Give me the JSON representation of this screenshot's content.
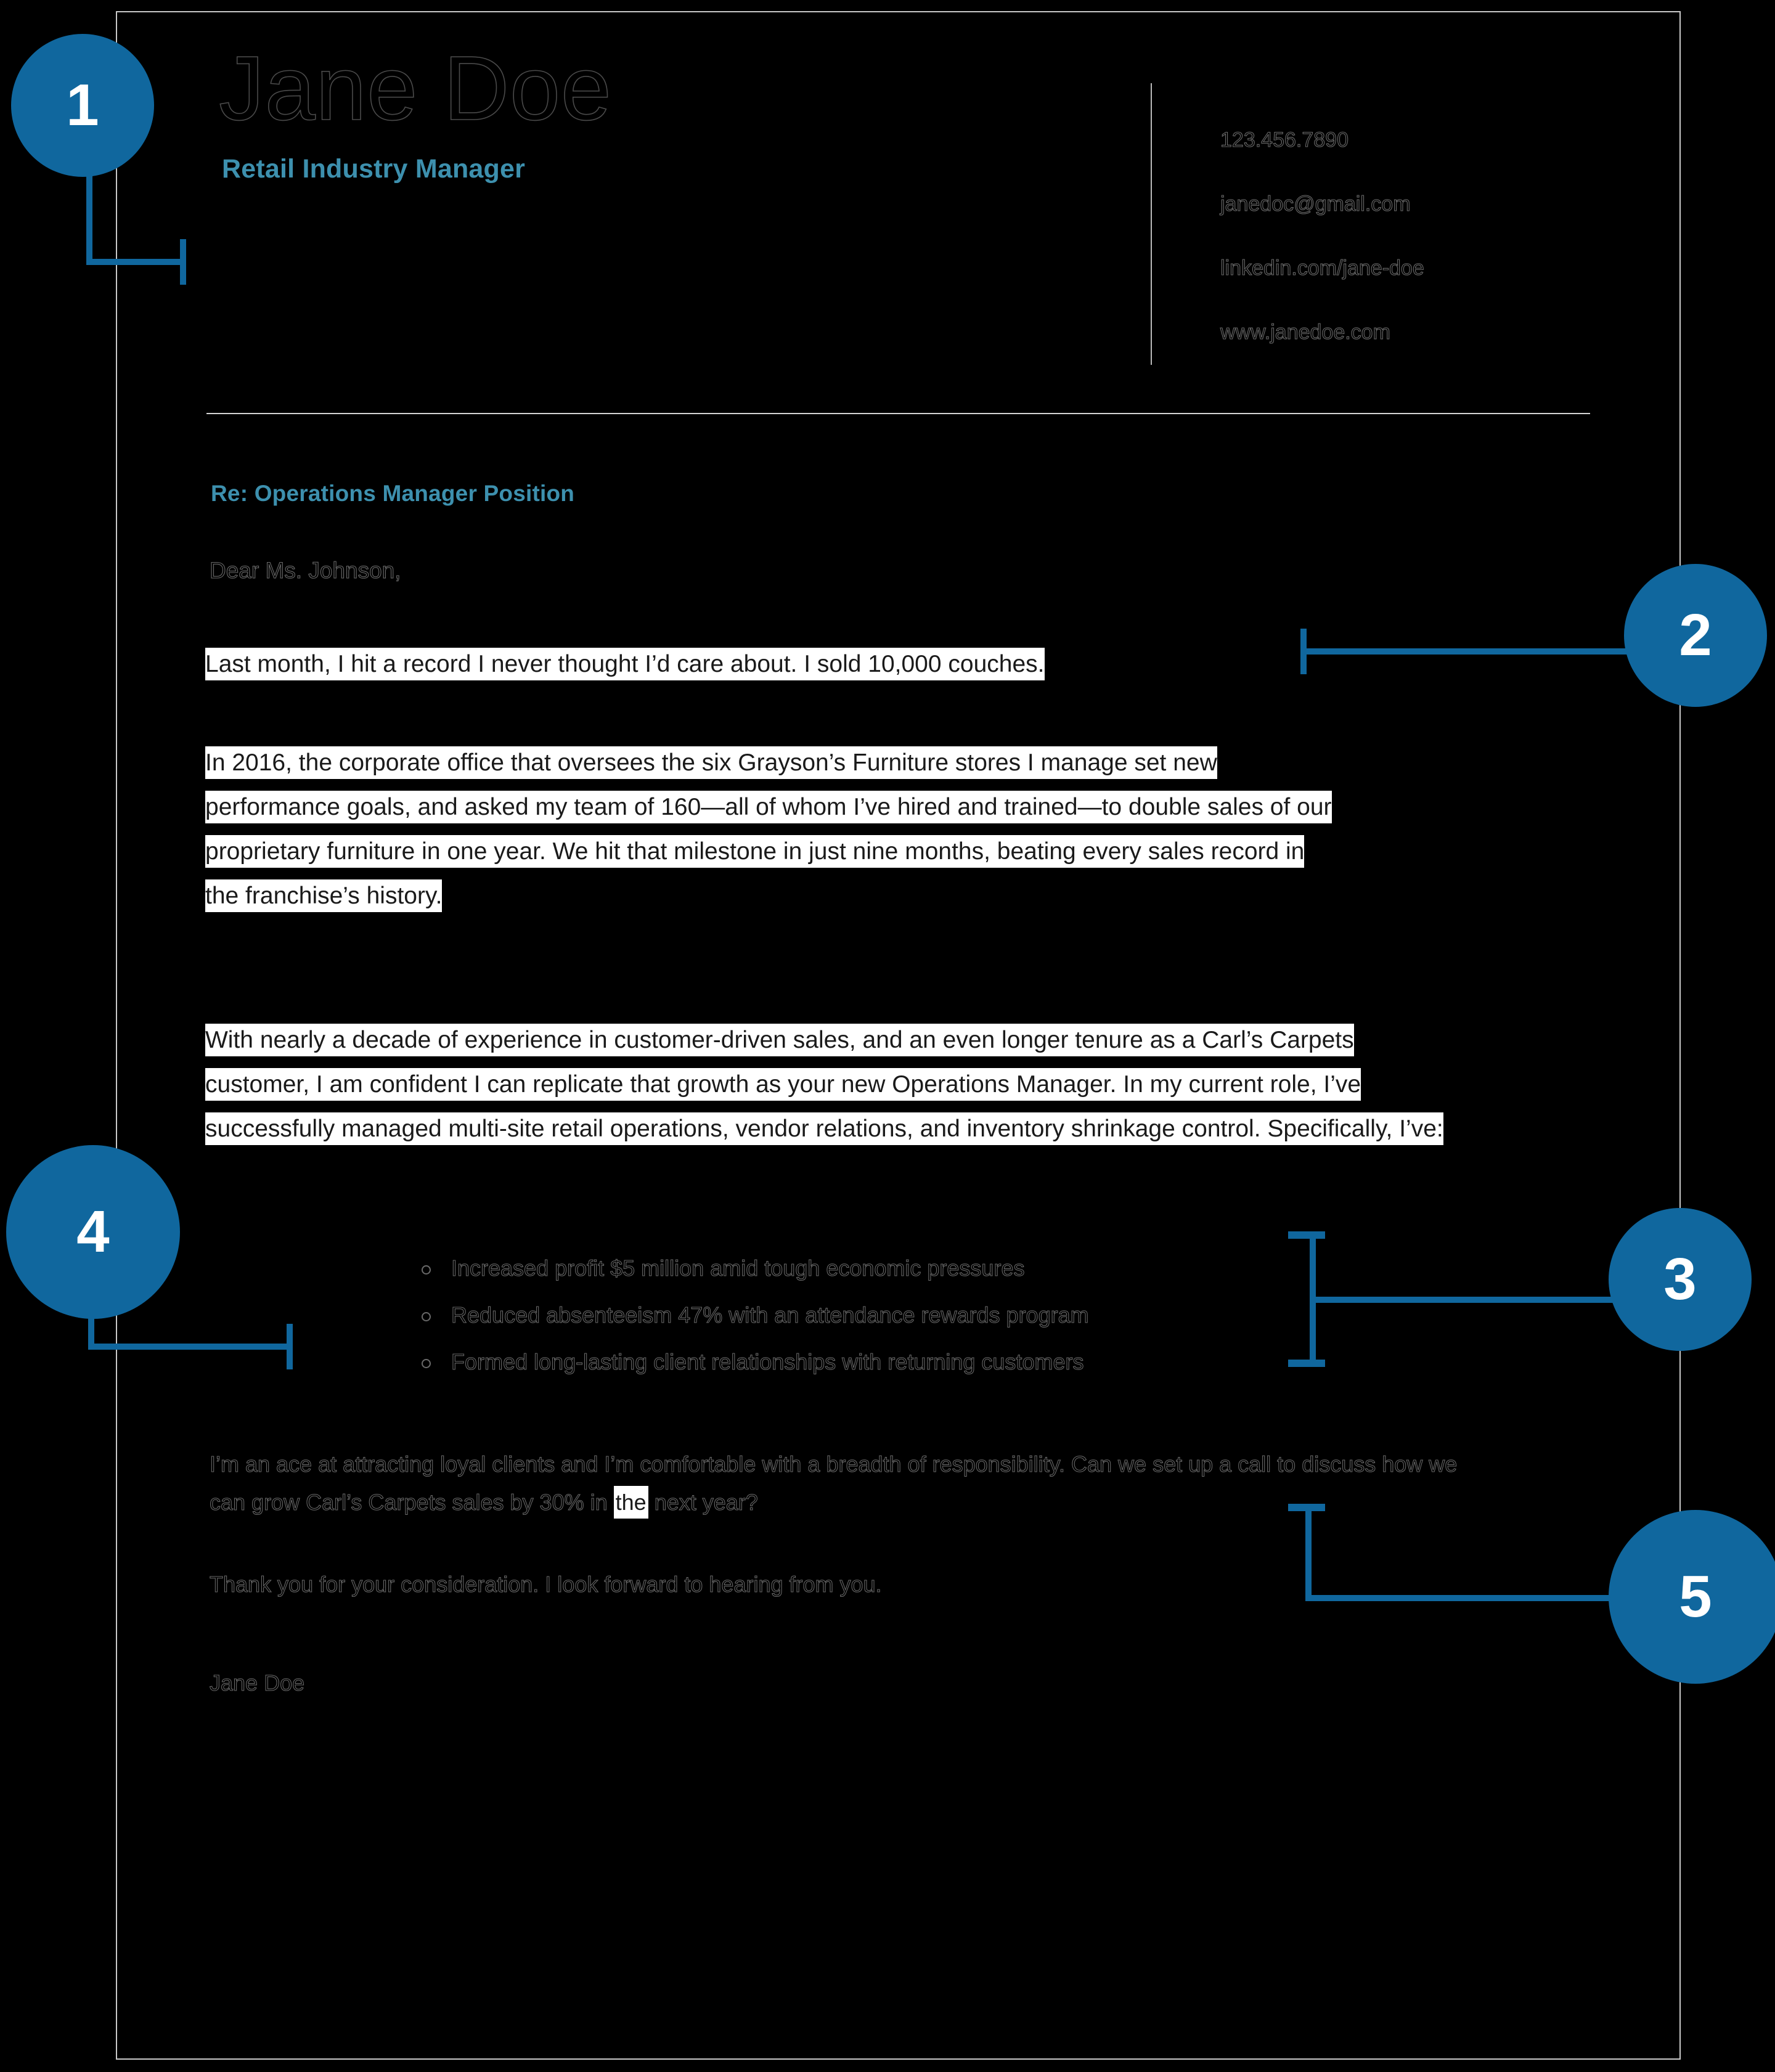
{
  "theme": {
    "background": "#000000",
    "accent_blue": "#10679e",
    "title_teal": "#3d90ae",
    "highlight": "#ffffff",
    "page_border": "#c9c9c9"
  },
  "header": {
    "name": "Jane Doe",
    "job_title": "Retail Industry Manager",
    "contact": [
      "123.456.7890",
      "janedoc@gmail.com",
      "linkedin.com/jane-doe",
      "www.janedoe.com"
    ]
  },
  "letter": {
    "subject": "Re: Operations Manager Position",
    "salutation": "Dear Ms. Johnson,",
    "paragraph_1": "Last month, I hit a record I never thought I’d care about. I sold 10,000 couches.",
    "paragraph_2": "In 2016, the corporate office that oversees the six Grayson’s Furniture stores I manage set new performance goals, and asked my team of 160—all of whom I’ve hired and trained—to double sales of our proprietary furniture in one year. We hit that milestone in just nine months, beating every sales record in the franchise’s history.",
    "paragraph_3": "With nearly a decade of experience in customer-driven sales, and an even longer tenure as a Carl’s Carpets customer, I am confident I can replicate that growth as your new Operations Manager. In my current role, I’ve successfully managed multi-site retail operations, vendor relations, and inventory shrinkage control. Specifically, I’ve:",
    "bullets": [
      "Increased profit $5 million amid tough economic pressures",
      "Reduced absenteeism 47% with an attendance rewards program",
      "Formed long-lasting client relationships with returning customers"
    ],
    "paragraph_4_before": "I’m an ace at attracting loyal clients and I’m comfortable with a breadth of responsibility. Can we set up a call to discuss how we can grow Carl’s Carpets sales by 30% in ",
    "paragraph_4_highlight": "the",
    "paragraph_4_after": " next year?",
    "paragraph_5": "Thank you for your consideration. I look forward to hearing from you.",
    "signature": "Jane Doe"
  },
  "callouts": [
    {
      "number": "1"
    },
    {
      "number": "2"
    },
    {
      "number": "3"
    },
    {
      "number": "4"
    },
    {
      "number": "5"
    }
  ]
}
